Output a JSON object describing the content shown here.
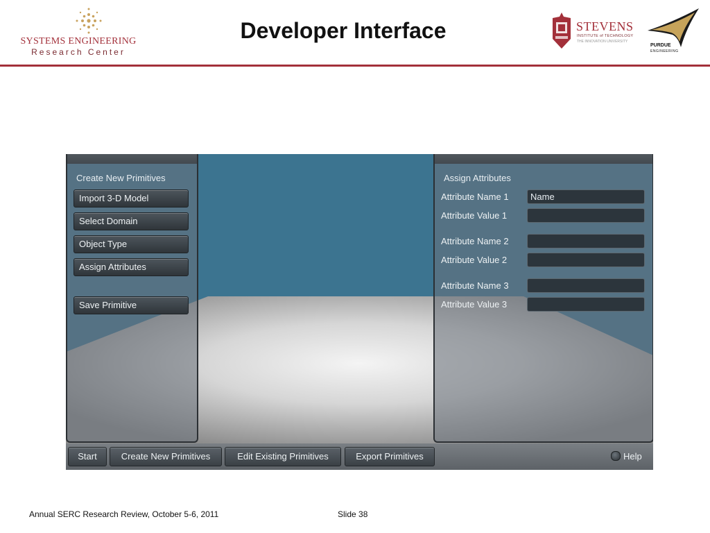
{
  "slide": {
    "title": "Developer Interface",
    "footer_left": "Annual SERC Research Review, October 5-6, 2011",
    "footer_right": "Slide 38"
  },
  "logos": {
    "serc_line1": "SYSTEMS ENGINEERING",
    "serc_line2": "Research Center",
    "stevens_name": "STEVENS",
    "stevens_sub1": "INSTITUTE of TECHNOLOGY",
    "stevens_sub2": "THE INNOVATION UNIVERSITY",
    "purdue_line1": "PURDUE",
    "purdue_line2": "ENGINEERING"
  },
  "app": {
    "left_panel": {
      "title": "Create New Primitives",
      "buttons": [
        "Import 3-D Model",
        "Select Domain",
        "Object Type",
        "Assign Attributes",
        "Save Primitive"
      ]
    },
    "right_panel": {
      "title": "Assign Attributes",
      "fields": [
        {
          "label": "Attribute Name 1",
          "value": "Name"
        },
        {
          "label": "Attribute Value 1",
          "value": ""
        },
        {
          "label": "Attribute Name 2",
          "value": ""
        },
        {
          "label": "Attribute Value 2",
          "value": ""
        },
        {
          "label": "Attribute Name 3",
          "value": ""
        },
        {
          "label": "Attribute Value 3",
          "value": ""
        }
      ]
    },
    "taskbar": {
      "buttons": [
        "Start",
        "Create New Primitives",
        "Edit Existing Primitives",
        "Export Primitives"
      ],
      "help": "Help"
    }
  },
  "colors": {
    "accent_red": "#a3303a",
    "sky_blue": "#3c7490",
    "panel_gray": "#69717a"
  },
  "icons": {
    "help": "help-circle-icon",
    "serc": "serc-star-logo-icon",
    "stevens": "stevens-shield-icon",
    "purdue": "purdue-motion-p-icon"
  }
}
